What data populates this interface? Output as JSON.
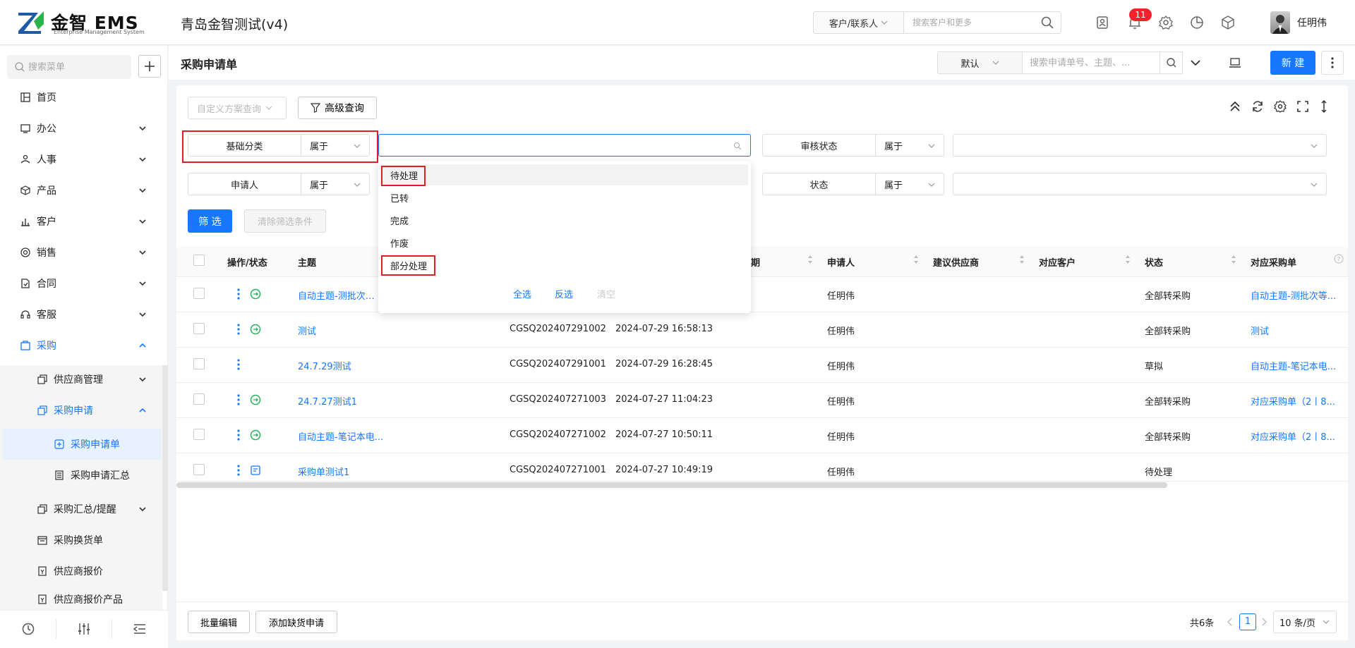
{
  "header": {
    "logo_text": "金智 EMS",
    "logo_sub": "Enterprise Management System",
    "system_title": "青岛金智测试(v4)",
    "search_scope": "客户/联系人",
    "search_placeholder": "搜索客户和更多",
    "notification_count": "11",
    "user_name": "任明伟"
  },
  "sidebar": {
    "search_placeholder": "搜索菜单",
    "items": [
      {
        "label": "首页",
        "icon": "home-icon"
      },
      {
        "label": "办公",
        "icon": "office-icon"
      },
      {
        "label": "人事",
        "icon": "hr-icon"
      },
      {
        "label": "产品",
        "icon": "product-icon"
      },
      {
        "label": "客户",
        "icon": "customer-icon"
      },
      {
        "label": "销售",
        "icon": "sales-icon"
      },
      {
        "label": "合同",
        "icon": "contract-icon"
      },
      {
        "label": "客服",
        "icon": "service-icon"
      },
      {
        "label": "采购",
        "icon": "purchase-icon"
      }
    ],
    "purchase_children": [
      {
        "label": "供应商管理"
      },
      {
        "label": "采购申请"
      },
      {
        "label": "采购申请单"
      },
      {
        "label": "采购申请汇总"
      },
      {
        "label": "采购汇总/提醒"
      },
      {
        "label": "采购换货单"
      },
      {
        "label": "供应商报价"
      },
      {
        "label": "供应商报价产品"
      }
    ]
  },
  "page": {
    "title": "采购申请单",
    "view_label": "默认",
    "search_placeholder": "搜索申请单号、主题、...",
    "new_button": "新 建"
  },
  "filters": {
    "scheme_placeholder": "自定义方案查询",
    "advanced_label": "高级查询",
    "row1": [
      {
        "label": "基础分类",
        "op": "属于"
      },
      {
        "label": "审核状态",
        "op": "属于"
      }
    ],
    "row2": [
      {
        "label": "申请人",
        "op": "属于"
      },
      {
        "label": "状态",
        "op": "属于"
      }
    ],
    "filter_button": "筛 选",
    "clear_button": "清除筛选条件"
  },
  "dropdown": {
    "options": [
      "待处理",
      "已转",
      "完成",
      "作废",
      "部分处理"
    ],
    "select_all": "全选",
    "invert": "反选",
    "clear": "清空"
  },
  "table": {
    "columns": [
      "操作/状态",
      "主题",
      "期",
      "申请人",
      "建议供应商",
      "对应客户",
      "状态",
      "对应采购单"
    ],
    "rows": [
      {
        "subject": "自动主题-测批次等...",
        "code": "",
        "date": "",
        "applicant": "任明伟",
        "status": "全部转采购",
        "po": "自动主题-测批次等..."
      },
      {
        "subject": "测试",
        "code": "CGSQ202407291002",
        "date": "2024-07-29 16:58:13",
        "applicant": "任明伟",
        "status": "全部转采购",
        "po": "测试"
      },
      {
        "subject": "24.7.29测试",
        "code": "CGSQ202407291001",
        "date": "2024-07-29 16:28:45",
        "applicant": "任明伟",
        "status": "草拟",
        "po": "自动主题-笔记本电..."
      },
      {
        "subject": "24.7.27测试1",
        "code": "CGSQ202407271003",
        "date": "2024-07-27 11:04:23",
        "applicant": "任明伟",
        "status": "全部转采购",
        "po": "对应采购单（2丨8..."
      },
      {
        "subject": "自动主题-笔记本电...",
        "code": "CGSQ202407271002",
        "date": "2024-07-27 10:50:11",
        "applicant": "任明伟",
        "status": "全部转采购",
        "po": "对应采购单（2丨8..."
      },
      {
        "subject": "采购单测试1",
        "code": "CGSQ202407271001",
        "date": "2024-07-27 10:49:19",
        "applicant": "任明伟",
        "status": "待处理",
        "po": ""
      }
    ]
  },
  "footer": {
    "batch_edit": "批量编辑",
    "add_shortage": "添加缺货申请",
    "total": "共6条",
    "page": "1",
    "page_size": "10 条/页"
  },
  "colors": {
    "primary": "#1677ff",
    "highlight": "#e02020",
    "badge": "#f5222d",
    "status_green": "#22b35a"
  }
}
